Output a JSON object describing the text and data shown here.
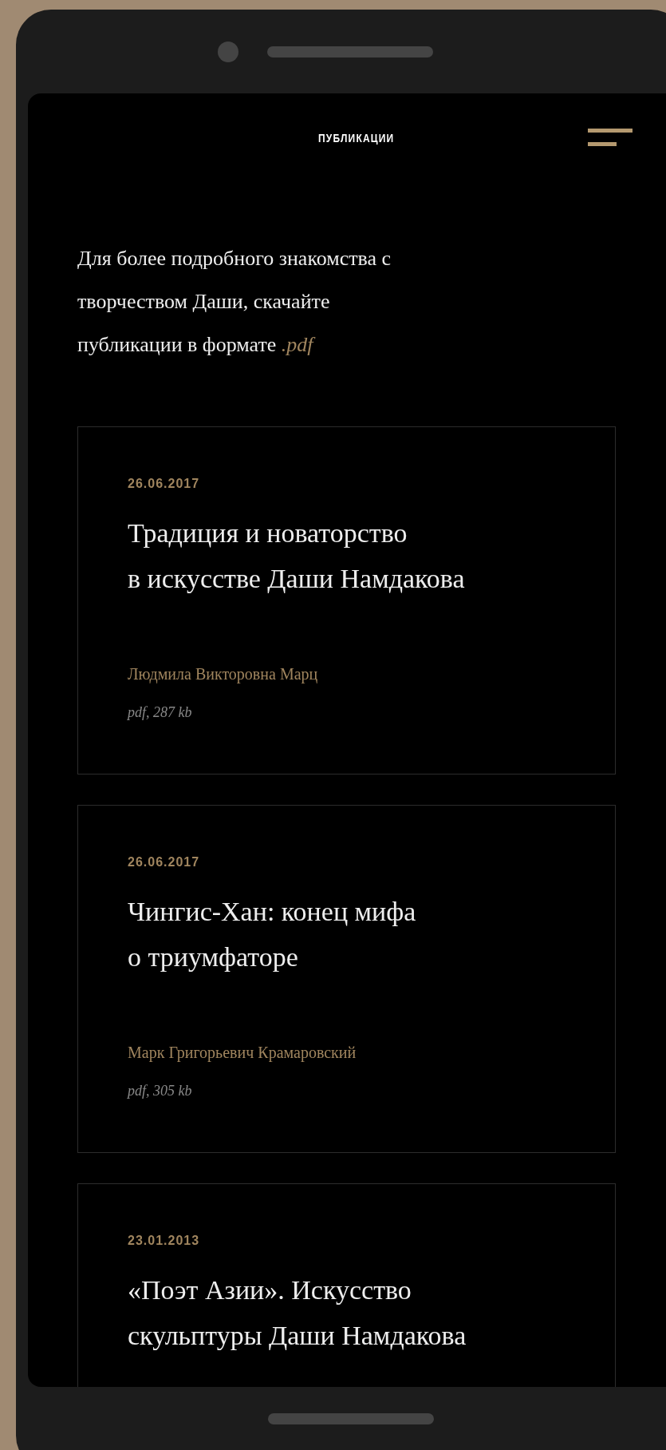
{
  "header": {
    "title": "ПУБЛИКАЦИИ"
  },
  "intro": {
    "text": "Для более подробного знакомства с творчеством Даши, скачайте публикации в формате",
    "format": ".pdf"
  },
  "publications": [
    {
      "date": "26.06.2017",
      "title_lines": [
        "Традиция и новаторство",
        "в искусстве Даши Намдакова"
      ],
      "author": "Людмила Викторовна Марц",
      "file": "pdf, 287 kb"
    },
    {
      "date": "26.06.2017",
      "title_lines": [
        "Чингис-Хан: конец мифа",
        "о триумфаторе"
      ],
      "author": "Марк Григорьевич Крамаровский",
      "file": "pdf, 305 kb"
    },
    {
      "date": "23.01.2013",
      "title_lines": [
        "«Поэт Азии». Искусство",
        "скульптуры Даши Намдакова"
      ]
    }
  ]
}
